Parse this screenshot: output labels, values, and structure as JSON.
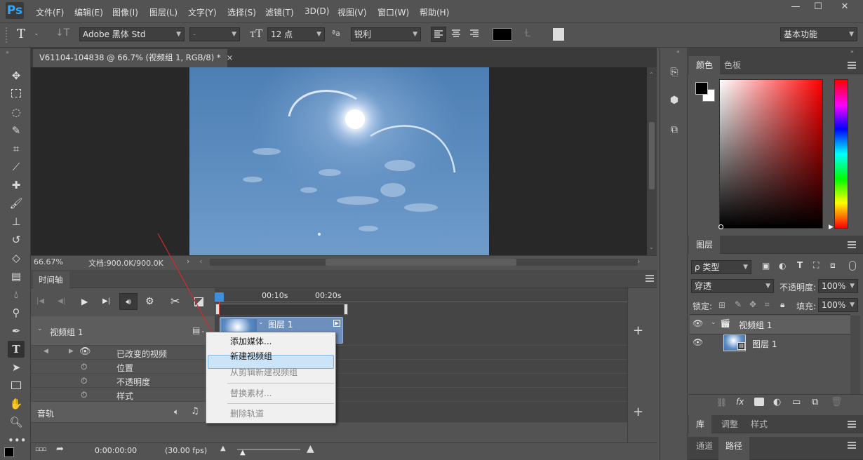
{
  "app": {
    "logo": "Ps"
  },
  "menu": [
    "文件(F)",
    "编辑(E)",
    "图像(I)",
    "图层(L)",
    "文字(Y)",
    "选择(S)",
    "滤镜(T)",
    "3D(D)",
    "视图(V)",
    "窗口(W)",
    "帮助(H)"
  ],
  "window_controls": {
    "minimize": "—",
    "restore": "☐",
    "close": "✕"
  },
  "options": {
    "tool_icon": "T",
    "font_family": "Adobe 黑体 Std",
    "font_style": "-",
    "font_size": "12 点",
    "aa_label": "ªa",
    "antialias": "锐利",
    "workspace": "基本功能"
  },
  "document": {
    "tab_title": "V61104-104838 @ 66.7% (视频组 1, RGB/8) *",
    "close": "×",
    "zoom": "66.67%",
    "doc_info": "文档:900.0K/900.0K"
  },
  "timeline": {
    "tab": "时间轴",
    "ruler_labels": [
      "00:10s",
      "00:20s"
    ],
    "clip_label": "图层 1",
    "track_group": "视频组 1",
    "props": [
      "已改变的视频",
      "位置",
      "不透明度",
      "样式"
    ],
    "audio_track": "音轨",
    "timecode": "0:00:00:00",
    "fps": "(30.00 fps)",
    "add": "+"
  },
  "context_menu": {
    "items": [
      {
        "label": "添加媒体...",
        "enabled": true
      },
      {
        "label": "新建视频组",
        "enabled": true,
        "highlighted": true
      },
      {
        "label": "从剪辑新建视频组",
        "enabled": false
      },
      {
        "label": "替换素材...",
        "enabled": false
      },
      {
        "label": "删除轨道",
        "enabled": false
      }
    ]
  },
  "panels": {
    "color_tabs": [
      "颜色",
      "色板"
    ],
    "layers_tab": "图层",
    "filter_kind": "ρ 类型",
    "blend_mode": "穿透",
    "opacity_label": "不透明度:",
    "opacity_value": "100%",
    "lock_label": "锁定:",
    "fill_label": "填充:",
    "fill_value": "100%",
    "layers": [
      {
        "name": "视频组 1",
        "type": "group"
      },
      {
        "name": "图层 1",
        "type": "video"
      }
    ],
    "bottom_tabs_1": [
      "库",
      "调整",
      "样式"
    ],
    "bottom_tabs_2": [
      "通道",
      "路径"
    ]
  },
  "colors": {
    "foreground": "#000000",
    "background": "#ffffff",
    "highlight": "#cce4f7",
    "ui_bg": "#535353"
  }
}
